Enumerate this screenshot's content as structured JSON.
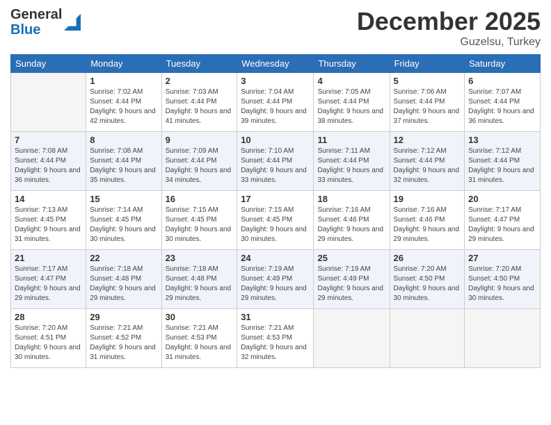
{
  "header": {
    "logo_general": "General",
    "logo_blue": "Blue",
    "month_title": "December 2025",
    "location": "Guzelsu, Turkey"
  },
  "weekdays": [
    "Sunday",
    "Monday",
    "Tuesday",
    "Wednesday",
    "Thursday",
    "Friday",
    "Saturday"
  ],
  "weeks": [
    [
      {
        "day": "",
        "sunrise": "",
        "sunset": "",
        "daylight": ""
      },
      {
        "day": "1",
        "sunrise": "7:02 AM",
        "sunset": "4:44 PM",
        "daylight": "9 hours and 42 minutes."
      },
      {
        "day": "2",
        "sunrise": "7:03 AM",
        "sunset": "4:44 PM",
        "daylight": "9 hours and 41 minutes."
      },
      {
        "day": "3",
        "sunrise": "7:04 AM",
        "sunset": "4:44 PM",
        "daylight": "9 hours and 39 minutes."
      },
      {
        "day": "4",
        "sunrise": "7:05 AM",
        "sunset": "4:44 PM",
        "daylight": "9 hours and 38 minutes."
      },
      {
        "day": "5",
        "sunrise": "7:06 AM",
        "sunset": "4:44 PM",
        "daylight": "9 hours and 37 minutes."
      },
      {
        "day": "6",
        "sunrise": "7:07 AM",
        "sunset": "4:44 PM",
        "daylight": "9 hours and 36 minutes."
      }
    ],
    [
      {
        "day": "7",
        "sunrise": "7:08 AM",
        "sunset": "4:44 PM",
        "daylight": "9 hours and 36 minutes."
      },
      {
        "day": "8",
        "sunrise": "7:08 AM",
        "sunset": "4:44 PM",
        "daylight": "9 hours and 35 minutes."
      },
      {
        "day": "9",
        "sunrise": "7:09 AM",
        "sunset": "4:44 PM",
        "daylight": "9 hours and 34 minutes."
      },
      {
        "day": "10",
        "sunrise": "7:10 AM",
        "sunset": "4:44 PM",
        "daylight": "9 hours and 33 minutes."
      },
      {
        "day": "11",
        "sunrise": "7:11 AM",
        "sunset": "4:44 PM",
        "daylight": "9 hours and 33 minutes."
      },
      {
        "day": "12",
        "sunrise": "7:12 AM",
        "sunset": "4:44 PM",
        "daylight": "9 hours and 32 minutes."
      },
      {
        "day": "13",
        "sunrise": "7:12 AM",
        "sunset": "4:44 PM",
        "daylight": "9 hours and 31 minutes."
      }
    ],
    [
      {
        "day": "14",
        "sunrise": "7:13 AM",
        "sunset": "4:45 PM",
        "daylight": "9 hours and 31 minutes."
      },
      {
        "day": "15",
        "sunrise": "7:14 AM",
        "sunset": "4:45 PM",
        "daylight": "9 hours and 30 minutes."
      },
      {
        "day": "16",
        "sunrise": "7:15 AM",
        "sunset": "4:45 PM",
        "daylight": "9 hours and 30 minutes."
      },
      {
        "day": "17",
        "sunrise": "7:15 AM",
        "sunset": "4:45 PM",
        "daylight": "9 hours and 30 minutes."
      },
      {
        "day": "18",
        "sunrise": "7:16 AM",
        "sunset": "4:46 PM",
        "daylight": "9 hours and 29 minutes."
      },
      {
        "day": "19",
        "sunrise": "7:16 AM",
        "sunset": "4:46 PM",
        "daylight": "9 hours and 29 minutes."
      },
      {
        "day": "20",
        "sunrise": "7:17 AM",
        "sunset": "4:47 PM",
        "daylight": "9 hours and 29 minutes."
      }
    ],
    [
      {
        "day": "21",
        "sunrise": "7:17 AM",
        "sunset": "4:47 PM",
        "daylight": "9 hours and 29 minutes."
      },
      {
        "day": "22",
        "sunrise": "7:18 AM",
        "sunset": "4:48 PM",
        "daylight": "9 hours and 29 minutes."
      },
      {
        "day": "23",
        "sunrise": "7:18 AM",
        "sunset": "4:48 PM",
        "daylight": "9 hours and 29 minutes."
      },
      {
        "day": "24",
        "sunrise": "7:19 AM",
        "sunset": "4:49 PM",
        "daylight": "9 hours and 29 minutes."
      },
      {
        "day": "25",
        "sunrise": "7:19 AM",
        "sunset": "4:49 PM",
        "daylight": "9 hours and 29 minutes."
      },
      {
        "day": "26",
        "sunrise": "7:20 AM",
        "sunset": "4:50 PM",
        "daylight": "9 hours and 30 minutes."
      },
      {
        "day": "27",
        "sunrise": "7:20 AM",
        "sunset": "4:50 PM",
        "daylight": "9 hours and 30 minutes."
      }
    ],
    [
      {
        "day": "28",
        "sunrise": "7:20 AM",
        "sunset": "4:51 PM",
        "daylight": "9 hours and 30 minutes."
      },
      {
        "day": "29",
        "sunrise": "7:21 AM",
        "sunset": "4:52 PM",
        "daylight": "9 hours and 31 minutes."
      },
      {
        "day": "30",
        "sunrise": "7:21 AM",
        "sunset": "4:53 PM",
        "daylight": "9 hours and 31 minutes."
      },
      {
        "day": "31",
        "sunrise": "7:21 AM",
        "sunset": "4:53 PM",
        "daylight": "9 hours and 32 minutes."
      },
      {
        "day": "",
        "sunrise": "",
        "sunset": "",
        "daylight": ""
      },
      {
        "day": "",
        "sunrise": "",
        "sunset": "",
        "daylight": ""
      },
      {
        "day": "",
        "sunrise": "",
        "sunset": "",
        "daylight": ""
      }
    ]
  ],
  "labels": {
    "sunrise": "Sunrise:",
    "sunset": "Sunset:",
    "daylight": "Daylight:"
  }
}
